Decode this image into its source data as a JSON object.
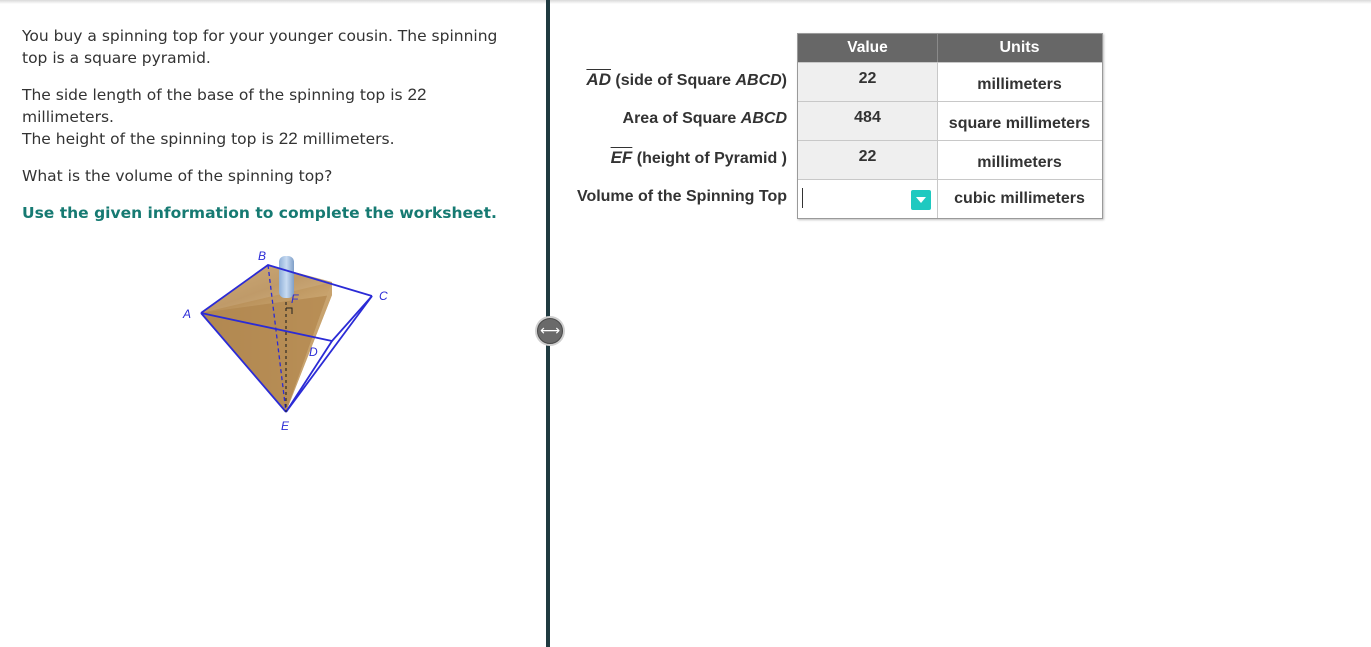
{
  "problem": {
    "intro": "You buy a spinning top for your younger cousin. The spinning top is a square pyramid.",
    "base_prefix": "The side length of the base of the spinning top is",
    "base_value": "22",
    "base_suffix": "millimeters.",
    "height_prefix": "The height of the spinning top is",
    "height_value": "22",
    "height_suffix": "millimeters.",
    "question": "What is the volume of the spinning top?",
    "instruction": "Use the given information to complete the worksheet."
  },
  "figure": {
    "labels": {
      "A": "A",
      "B": "B",
      "C": "C",
      "D": "D",
      "E": "E",
      "F": "F"
    }
  },
  "worksheet": {
    "headers": {
      "value": "Value",
      "units": "Units"
    },
    "rows": [
      {
        "label_segment": "AD",
        "label_text": " (side of Square ",
        "label_italic": "ABCD",
        "label_end": ")",
        "value": "22",
        "units": "millimeters"
      },
      {
        "label_text": "Area of Square ",
        "label_italic": "ABCD",
        "value": "484",
        "units": "square millimeters"
      },
      {
        "label_segment": "EF",
        "label_text": " (height of Pyramid )",
        "value": "22",
        "units": "millimeters"
      },
      {
        "label_text": "Volume of the Spinning Top",
        "value": "",
        "units": "cubic millimeters"
      }
    ]
  },
  "colors": {
    "accent_teal": "#167a72",
    "dropdown": "#1ec9c0",
    "header_bg": "#676767",
    "divider": "#1f3a40"
  },
  "icons": {
    "divider_handle": "resize-horizontal-icon",
    "dropdown": "chevron-down-icon"
  }
}
